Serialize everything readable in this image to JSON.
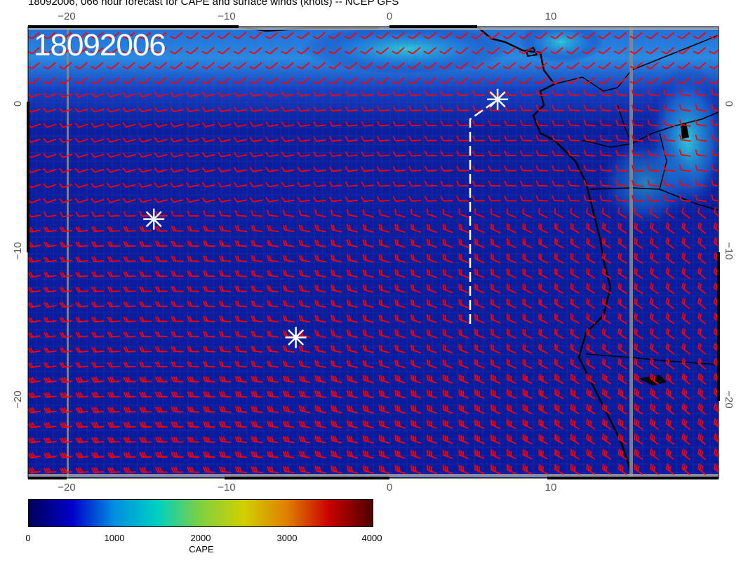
{
  "title": "18092006, 066 hour forecast for CAPE and surface winds (knots) -- NCEP GFS",
  "stamp": "18092006",
  "axes": {
    "lon_ticks": [
      "−20",
      "−10",
      "0",
      "10"
    ],
    "lat_ticks": [
      "0",
      "−10",
      "−20"
    ]
  },
  "colorbar": {
    "label": "CAPE",
    "ticks": [
      "0",
      "1000",
      "2000",
      "3000",
      "4000"
    ],
    "colors": [
      "#00005a",
      "#0000c8",
      "#0090e0",
      "#00d0c0",
      "#80d040",
      "#d0d000",
      "#e08000",
      "#c80000",
      "#500000"
    ]
  },
  "legend_colors": {
    "ocean_field": "#0a1a9c",
    "wind_barbs": "#ff0000",
    "coastline": "#000000",
    "markers": "#ffffff"
  },
  "markers": [
    {
      "name": "marker-north",
      "lon": 6.7,
      "lat": 0.3
    },
    {
      "name": "marker-west",
      "lon": -14.6,
      "lat": -7.8
    },
    {
      "name": "marker-south",
      "lon": -5.8,
      "lat": -15.8
    }
  ]
}
